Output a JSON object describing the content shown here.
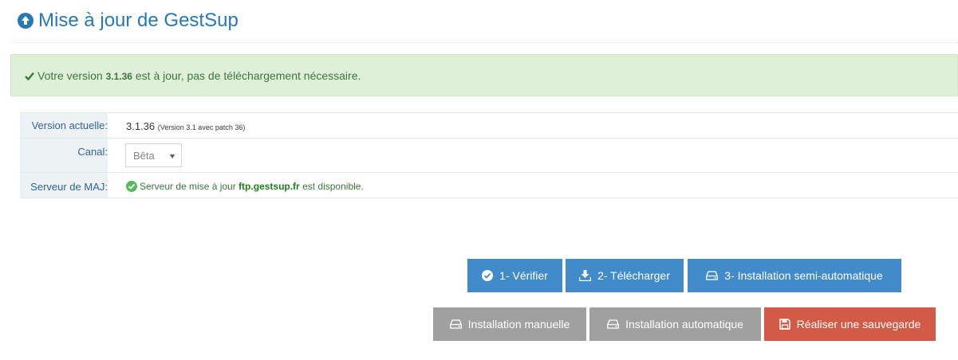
{
  "header": {
    "title": "Mise à jour de GestSup",
    "icon": "arrow-up-circle-icon"
  },
  "alert": {
    "prefix": "Votre version ",
    "version": "3.1.36",
    "suffix": " est à jour, pas de téléchargement nécessaire."
  },
  "info": {
    "version_label": "Version actuelle:",
    "version_value": "3.1.36",
    "version_detail": "(Version 3.1 avec patch 36)",
    "channel_label": "Canal:",
    "channel_value": "Bêta",
    "server_label": "Serveur de MAJ:",
    "server_prefix": "Serveur de mise à jour ",
    "server_host": "ftp.gestsup.fr",
    "server_suffix": " est disponible."
  },
  "buttons": {
    "verify": "1- Vérifier",
    "download": "2- Télécharger",
    "semi_auto": "3- Installation semi-automatique",
    "manual": "Installation manuelle",
    "auto": "Installation automatique",
    "backup": "Réaliser une sauvegarde"
  },
  "colors": {
    "primary": "#428bca",
    "grey": "#a0a0a0",
    "danger": "#d15b47",
    "success_bg": "#dff0d8",
    "success_text": "#3c763d"
  }
}
